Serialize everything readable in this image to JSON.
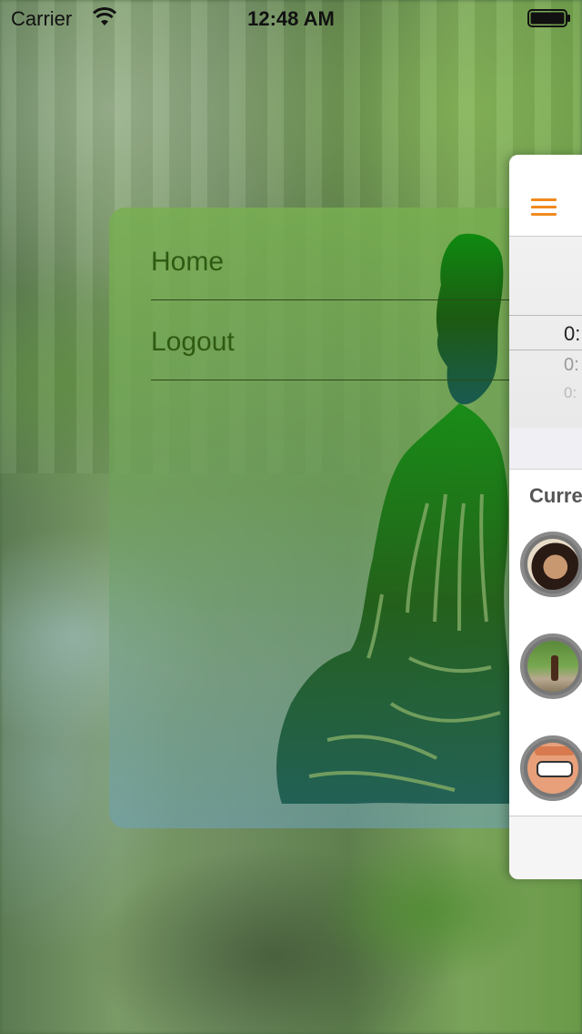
{
  "status_bar": {
    "carrier": "Carrier",
    "time": "12:48 AM",
    "wifi_icon": "wifi-icon",
    "battery_icon": "battery-icon"
  },
  "menu": {
    "items": [
      {
        "label": "Home"
      },
      {
        "label": "Logout"
      }
    ],
    "accent_color": "#2f5a12"
  },
  "app_preview": {
    "menu_icon": "hamburger-icon",
    "accent_color": "#f08a1e",
    "picker_values": [
      "0:",
      "0:",
      "0:"
    ],
    "section_title": "Curre",
    "avatars": [
      "avatar-woman",
      "avatar-forest",
      "avatar-cartoon"
    ]
  }
}
